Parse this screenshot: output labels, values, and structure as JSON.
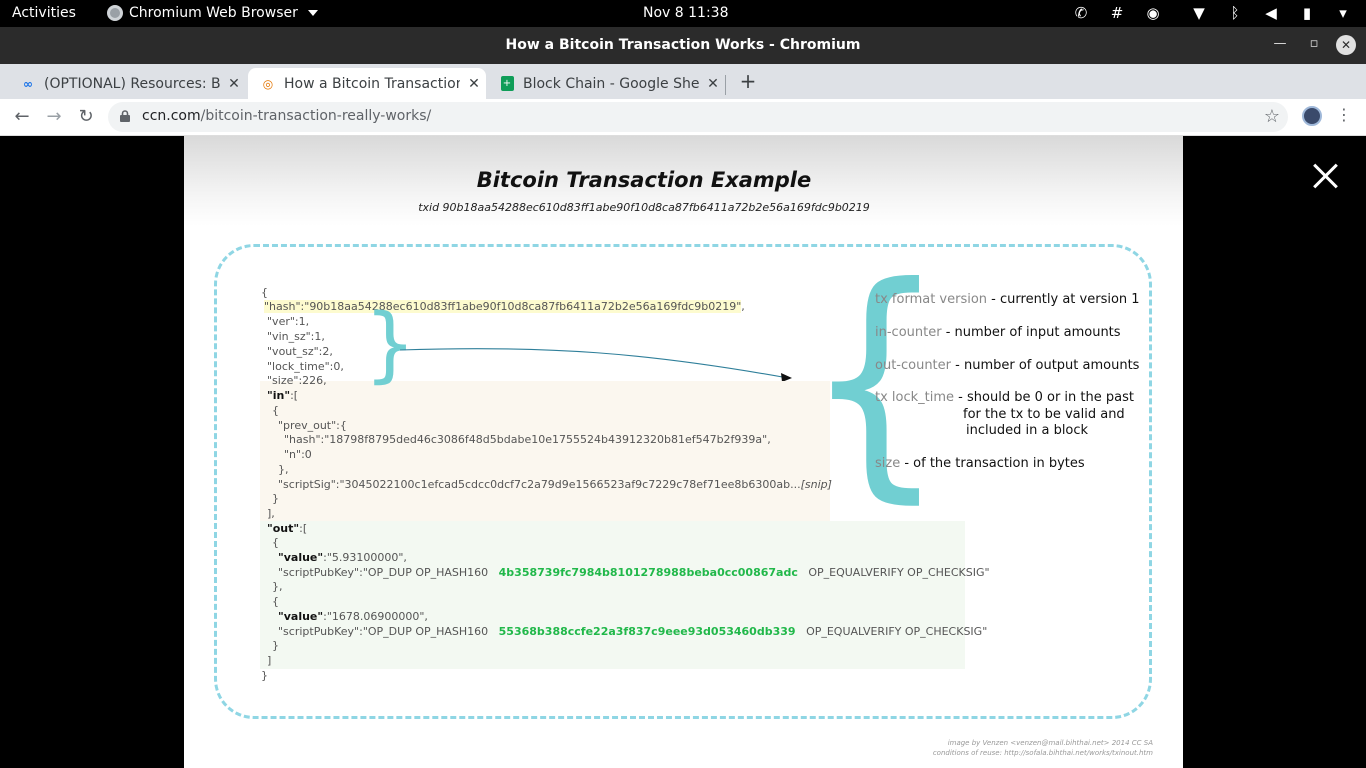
{
  "system_bar": {
    "activities": "Activities",
    "app_name": "Chromium Web Browser",
    "clock": "Nov 8  11:38",
    "tray_icons": [
      "whatsapp-icon",
      "slack-icon",
      "discord-icon",
      "wifi-icon",
      "bluetooth-icon",
      "volume-icon",
      "battery-icon",
      "power-icon"
    ]
  },
  "window": {
    "title": "How a Bitcoin Transaction Works - Chromium"
  },
  "tabs": [
    {
      "label": "(OPTIONAL) Resources: B",
      "icon": "link-icon",
      "active": false
    },
    {
      "label": "How a Bitcoin Transaction",
      "icon": "ccn-icon",
      "active": true
    },
    {
      "label": "Block Chain - Google Shee",
      "icon": "sheets-icon",
      "active": false
    }
  ],
  "toolbar": {
    "url_domain": "ccn.com",
    "url_path": "/bitcoin-transaction-really-works/"
  },
  "figure": {
    "title": "Bitcoin Transaction Example",
    "txid": "txid 90b18aa54288ec610d83ff1abe90f10d8ca87fb6411a72b2e56a169fdc9b0219",
    "code": {
      "open": "{",
      "hash_key": "\"hash\"",
      "hash_val": ":\"90b18aa54288ec610d83ff1abe90f10d8ca87fb6411a72b2e56a169fdc9b0219\"",
      "hash_comma": ",",
      "ver": "\"ver\":1,",
      "vin_sz": "\"vin_sz\":1,",
      "vout_sz": "\"vout_sz\":2,",
      "lock_time": "\"lock_time\":0,",
      "size": "\"size\":226,",
      "in_key": "\"in\"",
      "in_open": ":[",
      "in_obj_open": "{",
      "prev_out": "\"prev_out\":{",
      "prev_hash": "\"hash\":\"18798f8795ded46c3086f48d5bdabe10e1755524b43912320b81ef547b2f939a\",",
      "prev_n": "\"n\":0",
      "prev_close": "},",
      "scriptsig": "\"scriptSig\":\"3045022100c1efcad5cdcc0dcf7c2a79d9e1566523af9c7229c78ef71ee8b6300ab...",
      "snip": "[snip]",
      "in_obj_close": "}",
      "in_close": "],",
      "out_key": "\"out\"",
      "out_open": ":[",
      "out1_open": "{",
      "value_key": "\"value\"",
      "value1": ":\"5.93100000\",",
      "spk_prefix": "\"scriptPubKey\":\"OP_DUP OP_HASH160",
      "spk1_hash": "4b358739fc7984b8101278988beba0cc00867adc",
      "spk_suffix": "OP_EQUALVERIFY OP_CHECKSIG\"",
      "out1_close": "},",
      "out2_open": "{",
      "value2": ":\"1678.06900000\",",
      "spk2_hash": "55368b388ccfe22a3f837c9eee93d053460db339",
      "out2_close": "}",
      "out_close": "]",
      "close": "}"
    },
    "descriptions": [
      {
        "key": "tx format version",
        "text": " - currently at version 1"
      },
      {
        "key": "in-counter",
        "text": " - number of input amounts"
      },
      {
        "key": "out-counter",
        "text": " - number of output amounts"
      },
      {
        "key": "tx lock_time",
        "text": " - should be 0 or in the past",
        "line2": "for the tx to be valid and",
        "line3": "included in a block"
      },
      {
        "key": "size",
        "text": " - of the transaction in bytes"
      }
    ],
    "credit_line1": "image by Venzen <venzen@mail.bihthai.net> 2014 CC SA",
    "credit_line2": "conditions of reuse: http://sofala.bihthai.net/works/txinout.htm"
  },
  "colors": {
    "accent_brace": "#71cfd2",
    "dash_border": "#8fd6e4",
    "hash_green": "#21b84a"
  }
}
